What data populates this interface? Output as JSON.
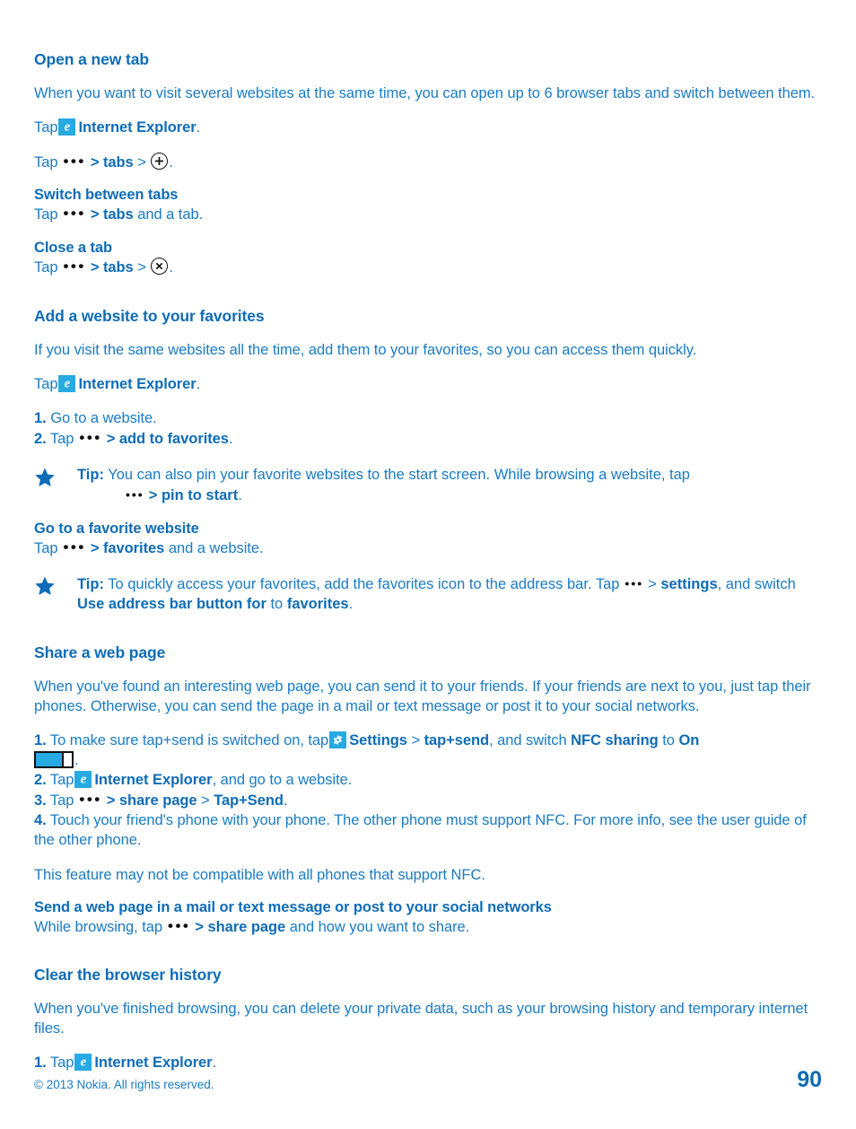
{
  "document": {
    "copyright": "© 2013 Nokia. All rights reserved.",
    "page_number": "90",
    "accent_color": "#0f6cb6",
    "body_color": "#1a7bc4",
    "icon_tile_color": "#27a9e1"
  },
  "sections": [
    {
      "id": "open-new-tab",
      "heading": "Open a new tab",
      "intro": "When you want to visit several websites at the same time, you can open up to 6 browser tabs and switch between them.",
      "tap_line": {
        "tap": "Tap",
        "icon": "ie-icon",
        "app": "Internet Explorer",
        "end": "."
      },
      "path_line": {
        "tap": "Tap",
        "dots": "•••",
        "gt1": ">",
        "item1": "tabs",
        "gt2": ">",
        "icon": "plus-circle-icon",
        "end": "."
      },
      "subsections": [
        {
          "id": "switch-between-tabs",
          "heading": "Switch between tabs",
          "tap": "Tap",
          "dots": "•••",
          "gt1": ">",
          "item1": "tabs",
          "tail": " and a tab."
        },
        {
          "id": "close-a-tab",
          "heading": "Close a tab",
          "tap": "Tap",
          "dots": "•••",
          "gt1": ">",
          "item1": "tabs",
          "gt2": ">",
          "icon": "close-circle-icon",
          "end": "."
        }
      ]
    },
    {
      "id": "add-website-favorites",
      "heading": "Add a website to your favorites",
      "intro": "If you visit the same websites all the time, add them to your favorites, so you can access them quickly.",
      "tap_line": {
        "tap": "Tap",
        "icon": "ie-icon",
        "app": "Internet Explorer",
        "end": "."
      },
      "steps": [
        {
          "num": "1.",
          "text": "Go to a website."
        },
        {
          "num": "2.",
          "tap": "Tap",
          "dots": "•••",
          "gt": ">",
          "item": "add to favorites",
          "end": "."
        }
      ],
      "tip": {
        "label": "Tip:",
        "text": "You can also pin your favorite websites to the start screen. While browsing a website, tap",
        "dots": "•••",
        "gt": ">",
        "item": "pin to start",
        "end": "."
      },
      "subsections": [
        {
          "id": "go-to-favorite-website",
          "heading": "Go to a favorite website",
          "tap": "Tap",
          "dots": "•••",
          "gt1": ">",
          "item1": "favorites",
          "tail": " and a website."
        }
      ],
      "tip2": {
        "label": "Tip:",
        "text_before": "To quickly access your favorites, add the favorites icon to the address bar. Tap",
        "dots": "•••",
        "gt": ">",
        "item1": "settings",
        "mid": ", and switch",
        "item2": "Use address bar button for",
        "mid2": "to",
        "item3": "favorites",
        "end": "."
      }
    },
    {
      "id": "share-web-page",
      "heading": "Share a web page",
      "intro": "When you've found an interesting web page, you can send it to your friends. If your friends are next to you, just tap their phones. Otherwise, you can send the page in a mail or text message or post it to your social networks.",
      "steps": [
        {
          "num": "1.",
          "before": "To make sure tap+send is switched on, tap",
          "icon": "gear-icon",
          "item1": "Settings",
          "gt": ">",
          "item2": "tap+send",
          "mid": ", and switch",
          "item3": "NFC sharing",
          "mid2": "to",
          "item4": "On",
          "toggle": "toggle-on-icon",
          "end": "."
        },
        {
          "num": "2.",
          "tap": "Tap",
          "icon": "ie-icon",
          "item1": "Internet Explorer",
          "tail": ", and go to a website."
        },
        {
          "num": "3.",
          "tap": "Tap",
          "dots": "•••",
          "gt1": ">",
          "item1": "share page",
          "gt2": ">",
          "item2": "Tap+Send",
          "end": "."
        },
        {
          "num": "4.",
          "text": "Touch your friend's phone with your phone. The other phone must support NFC. For more info, see the user guide of the other phone."
        }
      ],
      "note": "This feature may not be compatible with all phones that support NFC.",
      "subsections": [
        {
          "id": "send-web-page",
          "heading": "Send a web page in a mail or text message or post to your social networks",
          "tap": "While browsing, tap",
          "dots": "•••",
          "gt1": ">",
          "item1": "share page",
          "tail": " and how you want to share."
        }
      ]
    },
    {
      "id": "clear-browser-history",
      "heading": "Clear the browser history",
      "intro": "When you've finished browsing, you can delete your private data, such as your browsing history and temporary internet files.",
      "steps": [
        {
          "num": "1.",
          "tap": "Tap",
          "icon": "ie-icon",
          "item1": "Internet Explorer",
          "end": "."
        }
      ]
    }
  ]
}
